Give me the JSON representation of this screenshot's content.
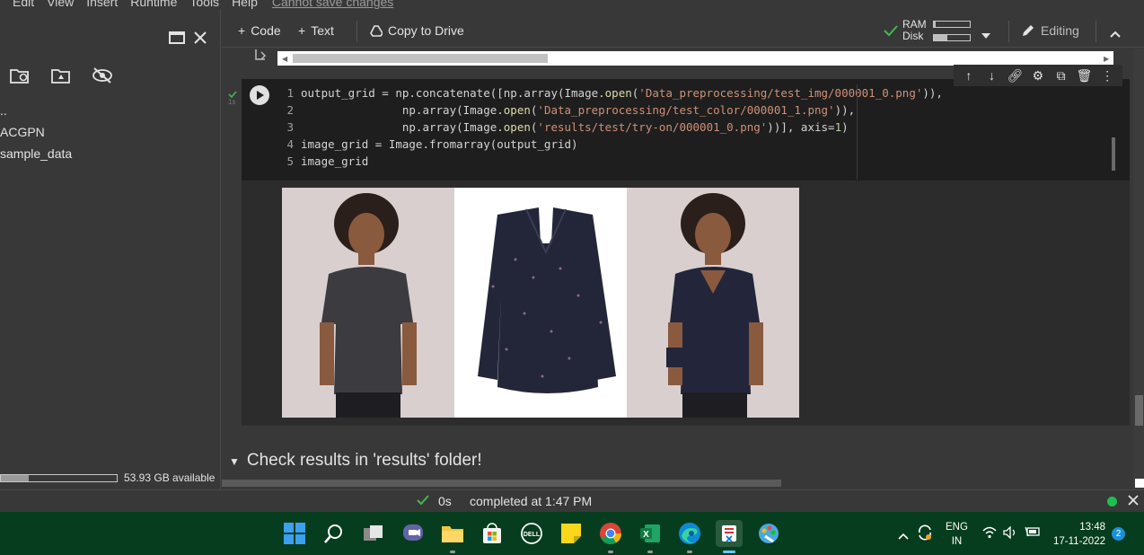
{
  "menu": {
    "items": [
      "Edit",
      "View",
      "Insert",
      "Runtime",
      "Tools",
      "Help"
    ],
    "unsaved": "Cannot save changes"
  },
  "sidebar": {
    "files": [
      "..",
      "ACGPN",
      "sample_data"
    ],
    "storage_text": "53.93 GB available",
    "storage_used_fraction": 0.24
  },
  "toolbar": {
    "code_label": "Code",
    "text_label": "Text",
    "drive_label": "Copy to Drive",
    "ram_label": "RAM",
    "disk_label": "Disk",
    "ram_fraction": 0.05,
    "disk_fraction": 0.38,
    "editing_label": "Editing"
  },
  "cell": {
    "exec_time": "1s",
    "lines": [
      {
        "n": "1",
        "parts": [
          [
            "plain",
            "output_grid = np.concatenate([np.array(Image."
          ],
          [
            "fn",
            "open"
          ],
          [
            "plain",
            "("
          ],
          [
            "str",
            "'Data_preprocessing/test_img/000001_0.png'"
          ],
          [
            "plain",
            ")),"
          ]
        ]
      },
      {
        "n": "2",
        "parts": [
          [
            "plain",
            "               np.array(Image."
          ],
          [
            "fn",
            "open"
          ],
          [
            "plain",
            "("
          ],
          [
            "str",
            "'Data_preprocessing/test_color/000001_1.png'"
          ],
          [
            "plain",
            ")),"
          ]
        ]
      },
      {
        "n": "3",
        "parts": [
          [
            "plain",
            "               np.array(Image."
          ],
          [
            "fn",
            "open"
          ],
          [
            "plain",
            "("
          ],
          [
            "str",
            "'results/test/try-on/000001_0.png'"
          ],
          [
            "plain",
            "))], axis="
          ],
          [
            "num",
            "1"
          ],
          [
            "plain",
            ")"
          ]
        ]
      },
      {
        "n": "4",
        "parts": [
          [
            "plain",
            "image_grid = Image.fromarray(output_grid)"
          ]
        ]
      },
      {
        "n": "5",
        "parts": [
          [
            "plain",
            "image_grid"
          ]
        ]
      }
    ]
  },
  "section": {
    "title": "Check results in 'results' folder!"
  },
  "status": {
    "time": "0s",
    "completed": "completed at 1:47 PM"
  },
  "taskbar": {
    "lang_top": "ENG",
    "lang_bottom": "IN",
    "time": "13:48",
    "date": "17-11-2022",
    "notif_count": "2"
  }
}
